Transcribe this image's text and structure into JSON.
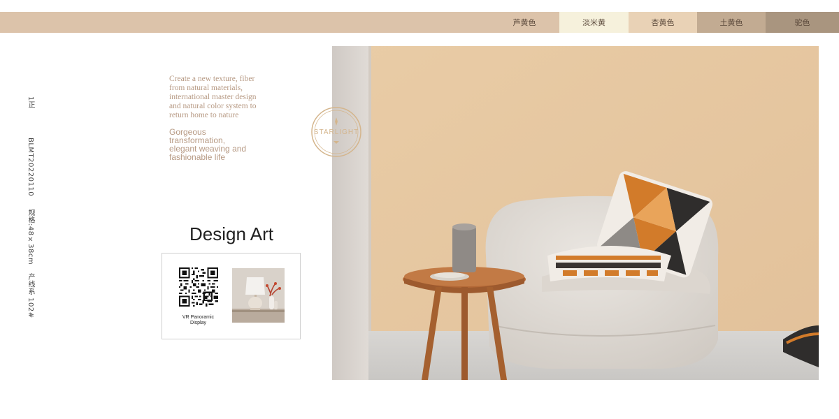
{
  "color_bar": {
    "swatches": [
      {
        "label": "芦黄色",
        "bg": "#dcc3aa",
        "active": false
      },
      {
        "label": "淡米黄",
        "bg": "#f6f1dc",
        "active": true
      },
      {
        "label": "杏黄色",
        "bg": "#e9d2b6",
        "active": false
      },
      {
        "label": "土黄色",
        "bg": "#c2ab92",
        "active": false
      },
      {
        "label": "驼色",
        "bg": "#a9957f",
        "active": false
      }
    ]
  },
  "side_label": {
    "sheet": "1正",
    "model": "BLMT20220110",
    "size": "规格:48×38cm",
    "product": "产线系 102#"
  },
  "intro": {
    "serif_lines": [
      "Create a new texture, fiber",
      "from natural materials,",
      "international master design",
      "and natural color system to",
      "return home to nature"
    ],
    "sans_lines": [
      "Gorgeous",
      "transformation,",
      "elegant weaving and",
      "fashionable life"
    ]
  },
  "design_title": "Design Art",
  "card": {
    "vr_label_line1": "VR Panoramic",
    "vr_label_line2": "Display"
  },
  "seal": {
    "text": "STARLIGHT"
  },
  "colors": {
    "wall": "#e7c9a2",
    "accent_text": "#b79a84",
    "bar": "#dcc3aa"
  }
}
